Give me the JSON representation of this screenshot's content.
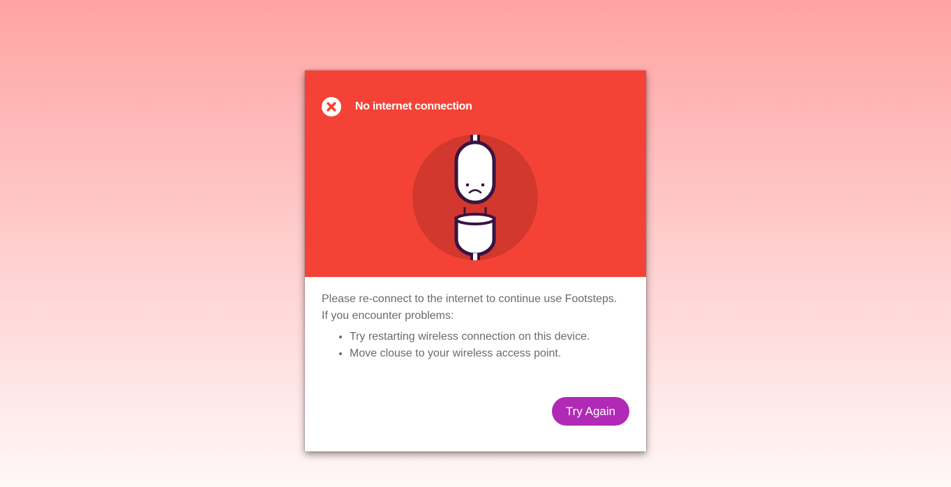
{
  "header": {
    "status_icon": "close-circle-icon",
    "status_text": "No internet connection",
    "illustration_icon": "unplugged-sad-plug-icon"
  },
  "body": {
    "message_line1": "Please re-connect to the internet to continue use Footsteps.",
    "message_line2": "If you encounter problems:",
    "tips": [
      "Try restarting wireless connection on this device.",
      "Move clouse to your wireless access point."
    ]
  },
  "actions": {
    "try_again_label": "Try Again"
  },
  "colors": {
    "header_bg": "#f44336",
    "illustration_circle": "#d2382d",
    "button_bg": "#b02ab5",
    "body_text": "#666a70"
  }
}
